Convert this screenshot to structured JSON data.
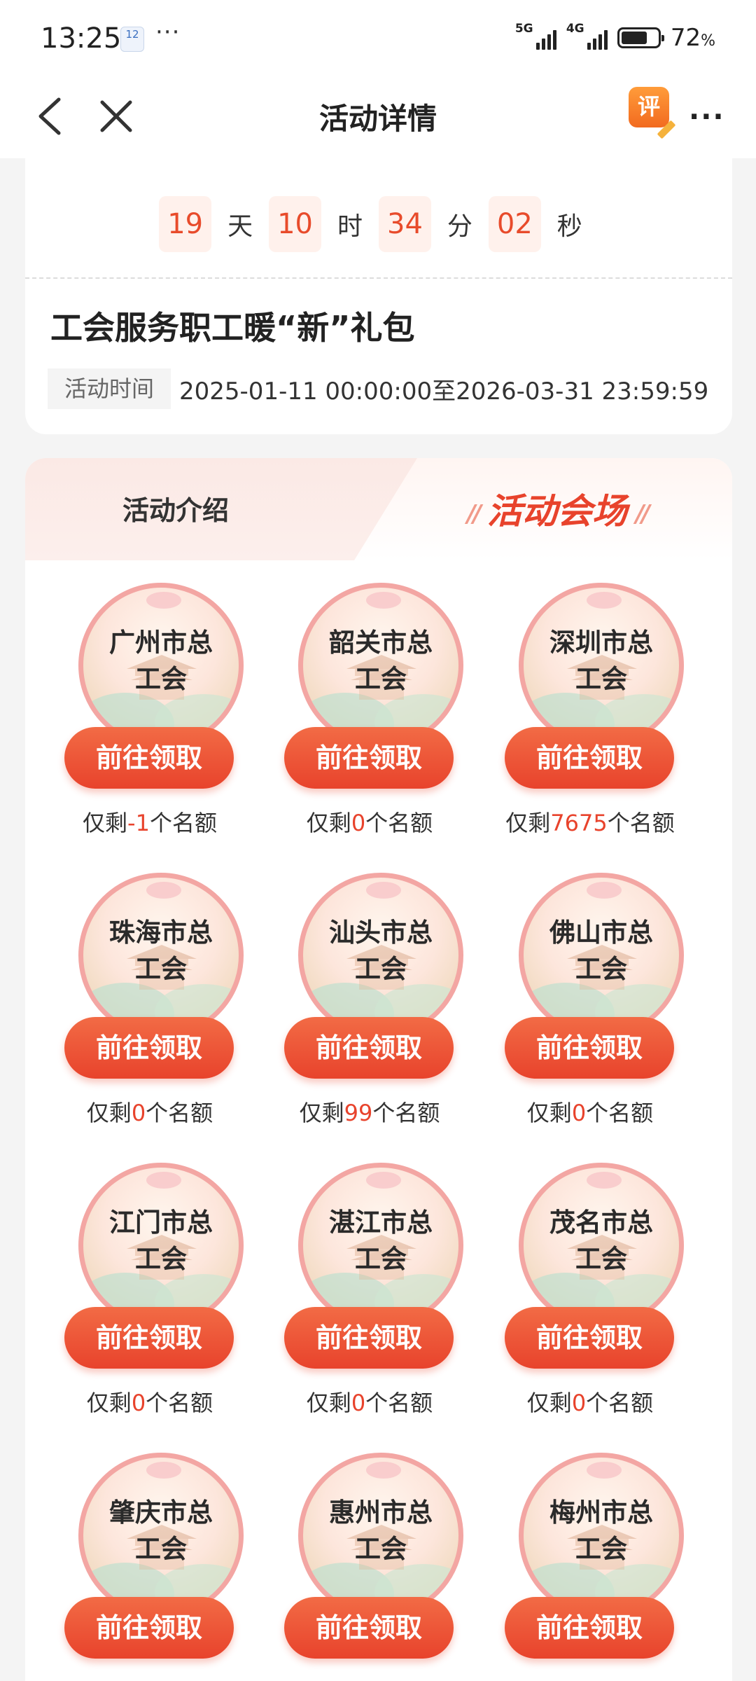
{
  "status_bar": {
    "time": "13:25",
    "calendar_day": "12",
    "more": "···",
    "signal1": "5G",
    "signal2": "4G",
    "battery_percent_value": 72,
    "battery": "72",
    "battery_unit": "%"
  },
  "nav": {
    "title": "活动详情",
    "review_label": "评",
    "more": "···"
  },
  "countdown": {
    "days": "19",
    "days_unit": "天",
    "hours": "10",
    "hours_unit": "时",
    "minutes": "34",
    "minutes_unit": "分",
    "seconds": "02",
    "seconds_unit": "秒"
  },
  "event": {
    "title": "工会服务职工暖“新”礼包",
    "time_label": "活动时间",
    "time_value": "2025-01-11 00:00:00至2026-03-31 23:59:59"
  },
  "tabs": {
    "intro": "活动介绍",
    "venue": "活动会场",
    "active": "venue"
  },
  "claim_button_label": "前往领取",
  "quota_prefix": "仅剩",
  "quota_suffix": "个名额",
  "venues": [
    {
      "name_line1": "广州市总",
      "name_line2": "工会",
      "remaining": "-1"
    },
    {
      "name_line1": "韶关市总",
      "name_line2": "工会",
      "remaining": "0"
    },
    {
      "name_line1": "深圳市总",
      "name_line2": "工会",
      "remaining": "7675"
    },
    {
      "name_line1": "珠海市总",
      "name_line2": "工会",
      "remaining": "0"
    },
    {
      "name_line1": "汕头市总",
      "name_line2": "工会",
      "remaining": "99"
    },
    {
      "name_line1": "佛山市总",
      "name_line2": "工会",
      "remaining": "0"
    },
    {
      "name_line1": "江门市总",
      "name_line2": "工会",
      "remaining": "0"
    },
    {
      "name_line1": "湛江市总",
      "name_line2": "工会",
      "remaining": "0"
    },
    {
      "name_line1": "茂名市总",
      "name_line2": "工会",
      "remaining": "0"
    },
    {
      "name_line1": "肇庆市总",
      "name_line2": "工会"
    },
    {
      "name_line1": "惠州市总",
      "name_line2": "工会"
    },
    {
      "name_line1": "梅州市总",
      "name_line2": "工会"
    }
  ],
  "colors": {
    "accent": "#e8432c",
    "badge_border": "#f3a6a3",
    "countdown_bg": "#fff1ec"
  }
}
